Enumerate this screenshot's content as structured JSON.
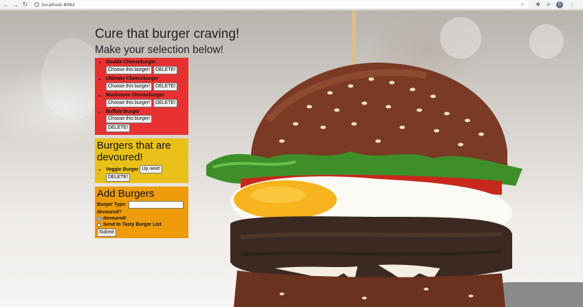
{
  "browser": {
    "url": "localhost:8082",
    "profile_initial": "S"
  },
  "header": {
    "title": "Cure that burger craving!",
    "subtitle": "Make your selection below!"
  },
  "available": {
    "items": [
      {
        "name": "Double Cheeseburger"
      },
      {
        "name": "Ultimate Cheeseburger"
      },
      {
        "name": "Mushroom Cheeseburger"
      },
      {
        "name": "Buffalo Burger"
      }
    ],
    "choose_label": "Choose this burger!",
    "delete_label": "DELETE!"
  },
  "devoured": {
    "heading": "Burgers that are devoured!",
    "items": [
      {
        "name": "Veggie Burger"
      }
    ],
    "next_label": "Up next!",
    "delete_label": "DELETE!"
  },
  "add": {
    "heading": "Add Burgers",
    "type_label": "Burger Type:",
    "type_value": "",
    "devoured_question": "devoured?",
    "option_devoured": "devoured!",
    "option_list": "Send to Tasty Burger List",
    "submit_label": "Submit"
  },
  "colors": {
    "red_panel": "#e83232",
    "yellow_panel": "#e9c01a",
    "orange_panel": "#ee9c0b"
  }
}
